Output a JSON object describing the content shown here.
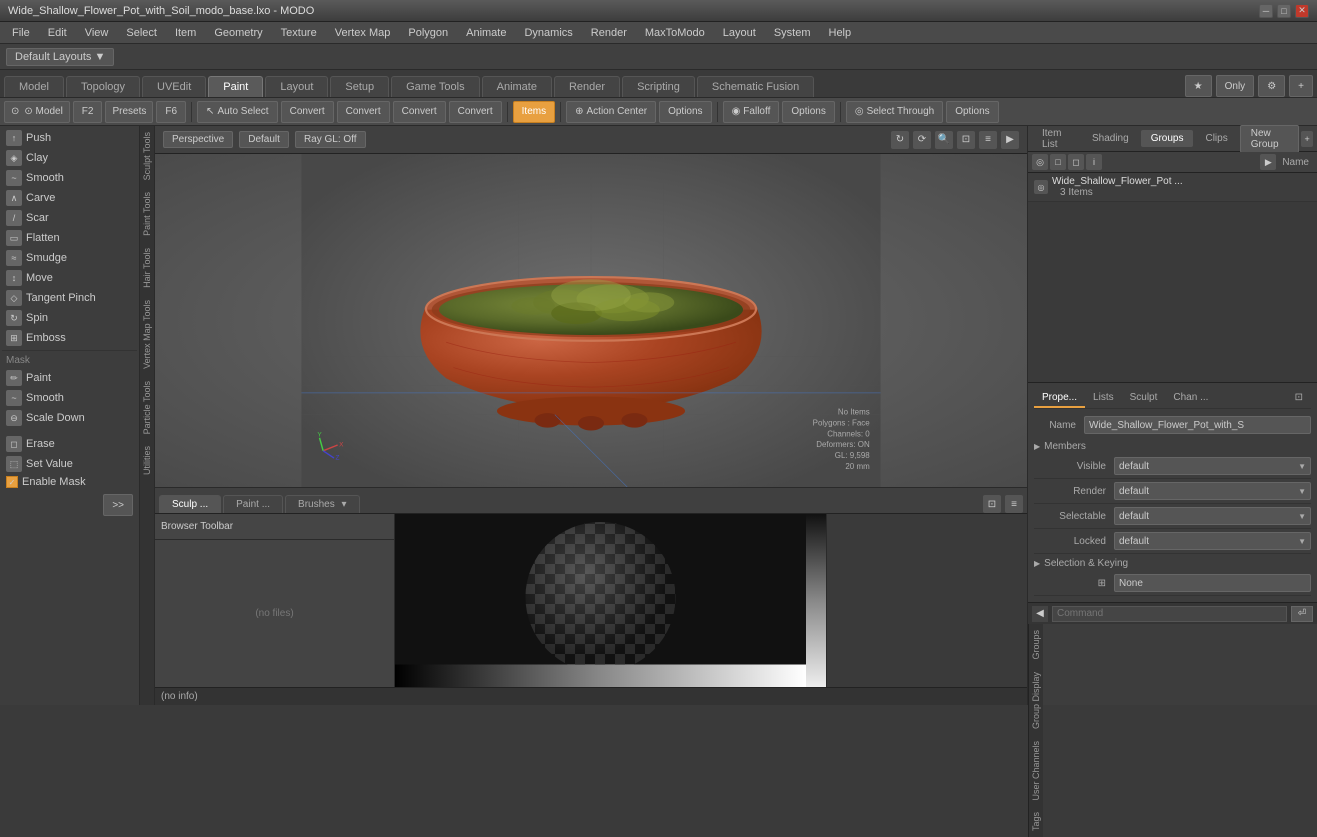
{
  "titlebar": {
    "title": "Wide_Shallow_Flower_Pot_with_Soil_modo_base.lxo - MODO",
    "logo": "MODO"
  },
  "menubar": {
    "items": [
      "File",
      "Edit",
      "View",
      "Select",
      "Item",
      "Geometry",
      "Texture",
      "Vertex Map",
      "Polygon",
      "Animate",
      "Dynamics",
      "Render",
      "MaxToModo",
      "Layout",
      "System",
      "Help"
    ]
  },
  "layoutbar": {
    "label": "Default Layouts ▼"
  },
  "tabs": {
    "items": [
      "Model",
      "Topology",
      "UVEdit",
      "Paint",
      "Layout",
      "Setup",
      "Game Tools",
      "Animate",
      "Render",
      "Scripting",
      "Schematic Fusion"
    ],
    "active": "Paint"
  },
  "toolbar": {
    "mode_btn": "⊙ Model",
    "f2": "F2",
    "presets": "Presets",
    "f6": "F6",
    "auto_select": "Auto Select",
    "convert1": "Convert",
    "convert2": "Convert",
    "convert3": "Convert",
    "convert4": "Convert",
    "items": "Items",
    "action_center": "Action Center",
    "options1": "Options",
    "falloff": "Falloff",
    "options2": "Options",
    "select_through": "Select Through",
    "options3": "Options"
  },
  "viewport": {
    "perspective_label": "Perspective",
    "default_label": "Default",
    "raygl_label": "Ray GL: Off",
    "no_items": "No Items",
    "polygons": "Polygons : Face",
    "channels": "Channels: 0",
    "deformers": "Deformers: ON",
    "gl": "GL: 9,598",
    "size": "20 mm"
  },
  "sculpt_tools": {
    "items": [
      {
        "name": "Push",
        "icon": "↑"
      },
      {
        "name": "Clay",
        "icon": "◈"
      },
      {
        "name": "Smooth",
        "icon": "~"
      },
      {
        "name": "Carve",
        "icon": "∧"
      },
      {
        "name": "Scar",
        "icon": "/"
      },
      {
        "name": "Flatten",
        "icon": "▭"
      },
      {
        "name": "Smudge",
        "icon": "≈"
      },
      {
        "name": "Move",
        "icon": "↕"
      },
      {
        "name": "Tangent Pinch",
        "icon": "◇"
      },
      {
        "name": "Spin",
        "icon": "↻"
      },
      {
        "name": "Emboss",
        "icon": "⊞"
      }
    ],
    "mask_section": "Mask",
    "mask_items": [
      {
        "name": "Paint",
        "icon": "✏"
      },
      {
        "name": "Smooth",
        "icon": "~"
      },
      {
        "name": "Scale Down",
        "icon": "⊖"
      }
    ],
    "erase": "Erase",
    "set_value": "Set Value",
    "enable_mask": "Enable Mask"
  },
  "side_tabs": [
    "Sculpt Tools",
    "Paint Tools",
    "Hair Tools",
    "Vertex Map Tools",
    "Particle Tools",
    "Utilities"
  ],
  "bottom": {
    "tabs": [
      "Sculp ...",
      "Paint ...",
      "Brushes"
    ],
    "browser_toolbar": "Browser Toolbar",
    "no_files": "(no files)",
    "no_info": "(no info)"
  },
  "right_panel": {
    "tabs": [
      "Item List",
      "Shading",
      "Groups",
      "Clips"
    ],
    "active_tab": "Groups",
    "new_group": "New Group",
    "name_header": "Name",
    "group_name": "Wide_Shallow_Flower_Pot ...",
    "group_sub": "3 Items",
    "props_tabs": [
      "Prope...",
      "Lists",
      "Sculpt",
      "Chan ..."
    ],
    "name_label": "Name",
    "name_value": "Wide_Shallow_Flower_Pot_with_S",
    "members_section": "Members",
    "visible_label": "Visible",
    "visible_value": "default",
    "render_label": "Render",
    "render_value": "default",
    "selectable_label": "Selectable",
    "selectable_value": "default",
    "locked_label": "Locked",
    "locked_value": "default",
    "selection_section": "Selection & Keying",
    "none_label": "None",
    "side_tabs": [
      "Groups",
      "Group Display",
      "User Channels",
      "Tags"
    ]
  },
  "command_bar": {
    "placeholder": "Command"
  }
}
